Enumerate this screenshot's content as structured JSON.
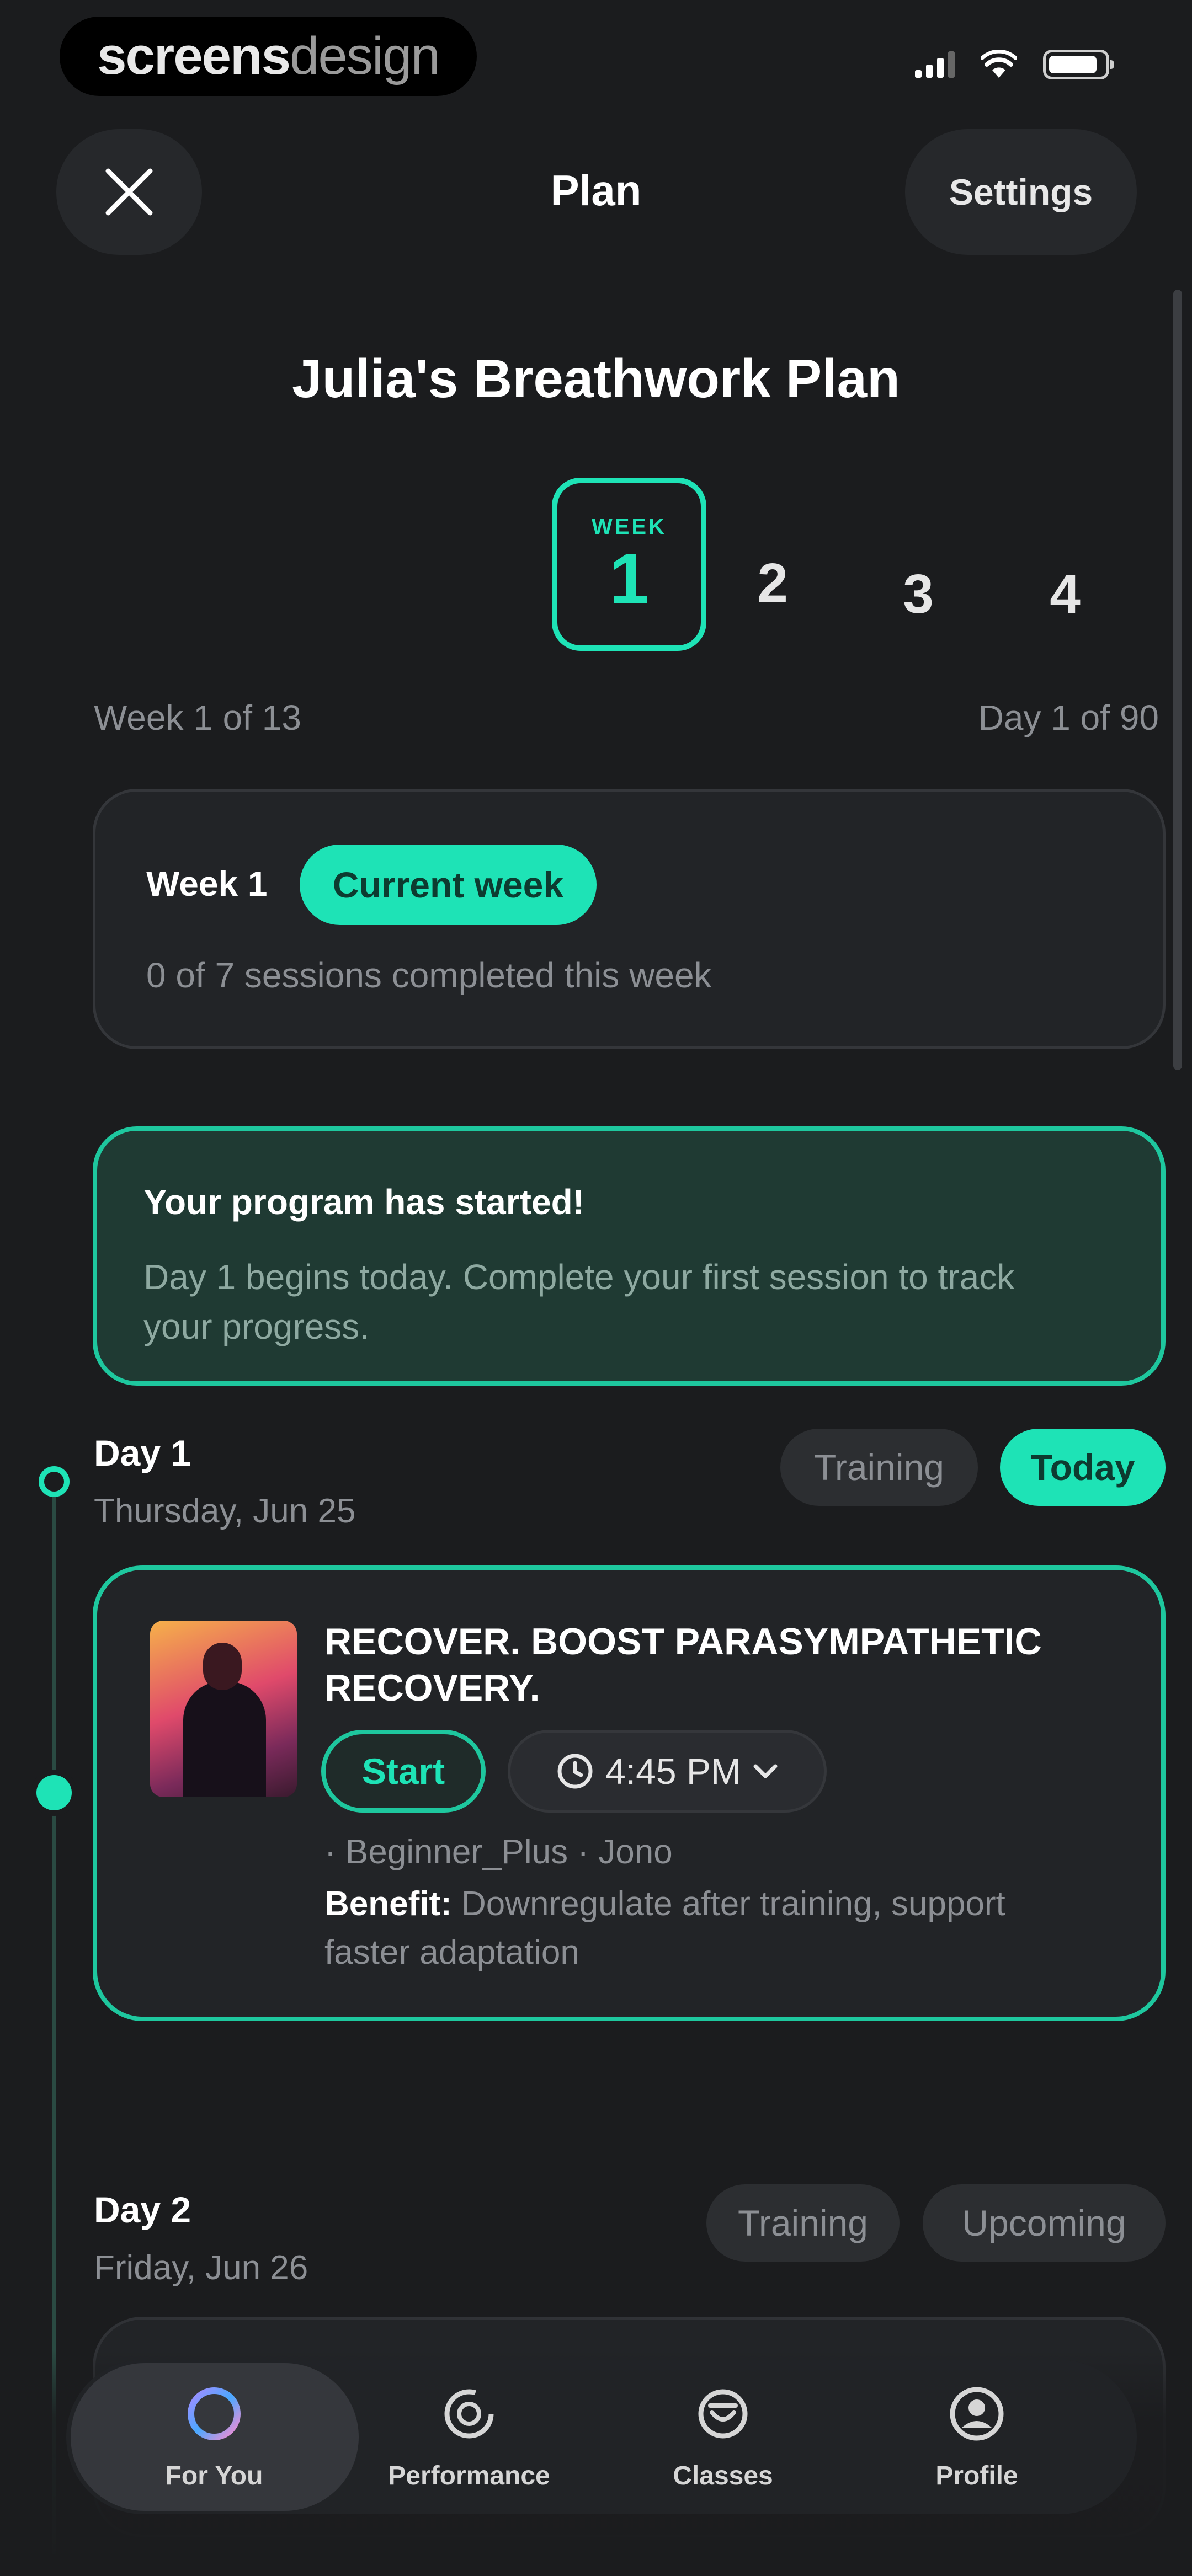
{
  "status_bar": {
    "brand_bold": "screens",
    "brand_light": "design"
  },
  "header": {
    "title": "Plan",
    "settings_label": "Settings"
  },
  "plan": {
    "title": "Julia's Breathwork Plan",
    "weeks": {
      "active_label": "WEEK",
      "active_number": "1",
      "others": [
        "2",
        "3",
        "4"
      ]
    },
    "week_progress": "Week 1 of 13",
    "day_progress": "Day 1 of 90"
  },
  "week_card": {
    "title": "Week 1",
    "badge": "Current week",
    "sessions": "0 of 7 sessions completed this week"
  },
  "started_card": {
    "title": "Your program has started!",
    "description": "Day 1 begins today. Complete your first session to track your progress."
  },
  "days": [
    {
      "title": "Day 1",
      "date": "Thursday, Jun 25",
      "tag": "Training",
      "status": "Today",
      "session": {
        "title": "RECOVER. BOOST PARASYMPATHETIC RECOVERY.",
        "start_label": "Start",
        "time": "4:45 PM",
        "meta": "· Beginner_Plus · Jono",
        "benefit_label": "Benefit:",
        "benefit_text": "Downregulate after training, support faster adaptation"
      }
    },
    {
      "title": "Day 2",
      "date": "Friday, Jun 26",
      "tag": "Training",
      "status": "Upcoming"
    }
  ],
  "nav": {
    "items": [
      {
        "label": "For You",
        "icon": "circle-icon"
      },
      {
        "label": "Performance",
        "icon": "performance-icon"
      },
      {
        "label": "Classes",
        "icon": "classes-icon"
      },
      {
        "label": "Profile",
        "icon": "profile-icon"
      }
    ]
  },
  "colors": {
    "accent": "#1ee3b6",
    "background": "#1b1c1e",
    "card": "#222427",
    "started_card": "#1f3a33"
  }
}
